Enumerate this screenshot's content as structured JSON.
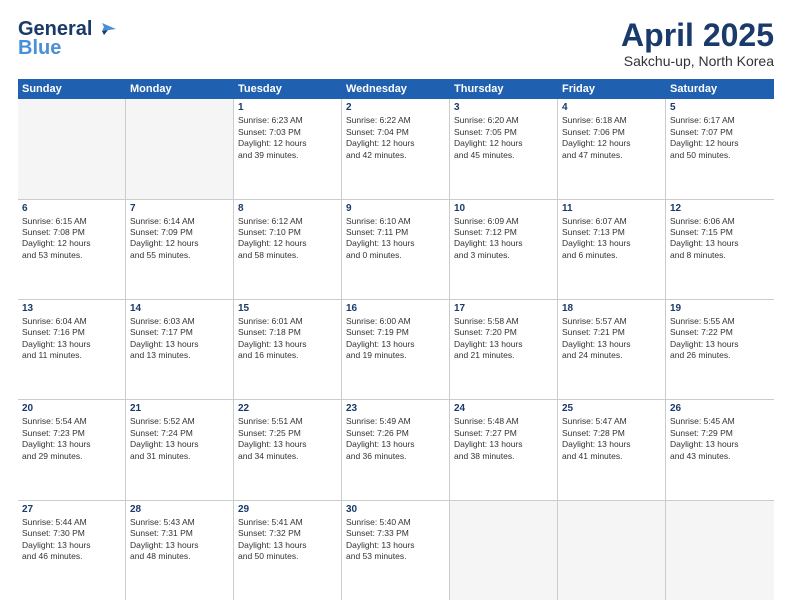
{
  "header": {
    "logo_general": "General",
    "logo_blue": "Blue",
    "title": "April 2025",
    "subtitle": "Sakchu-up, North Korea"
  },
  "weekdays": [
    "Sunday",
    "Monday",
    "Tuesday",
    "Wednesday",
    "Thursday",
    "Friday",
    "Saturday"
  ],
  "weeks": [
    [
      {
        "day": "",
        "lines": []
      },
      {
        "day": "",
        "lines": []
      },
      {
        "day": "1",
        "lines": [
          "Sunrise: 6:23 AM",
          "Sunset: 7:03 PM",
          "Daylight: 12 hours",
          "and 39 minutes."
        ]
      },
      {
        "day": "2",
        "lines": [
          "Sunrise: 6:22 AM",
          "Sunset: 7:04 PM",
          "Daylight: 12 hours",
          "and 42 minutes."
        ]
      },
      {
        "day": "3",
        "lines": [
          "Sunrise: 6:20 AM",
          "Sunset: 7:05 PM",
          "Daylight: 12 hours",
          "and 45 minutes."
        ]
      },
      {
        "day": "4",
        "lines": [
          "Sunrise: 6:18 AM",
          "Sunset: 7:06 PM",
          "Daylight: 12 hours",
          "and 47 minutes."
        ]
      },
      {
        "day": "5",
        "lines": [
          "Sunrise: 6:17 AM",
          "Sunset: 7:07 PM",
          "Daylight: 12 hours",
          "and 50 minutes."
        ]
      }
    ],
    [
      {
        "day": "6",
        "lines": [
          "Sunrise: 6:15 AM",
          "Sunset: 7:08 PM",
          "Daylight: 12 hours",
          "and 53 minutes."
        ]
      },
      {
        "day": "7",
        "lines": [
          "Sunrise: 6:14 AM",
          "Sunset: 7:09 PM",
          "Daylight: 12 hours",
          "and 55 minutes."
        ]
      },
      {
        "day": "8",
        "lines": [
          "Sunrise: 6:12 AM",
          "Sunset: 7:10 PM",
          "Daylight: 12 hours",
          "and 58 minutes."
        ]
      },
      {
        "day": "9",
        "lines": [
          "Sunrise: 6:10 AM",
          "Sunset: 7:11 PM",
          "Daylight: 13 hours",
          "and 0 minutes."
        ]
      },
      {
        "day": "10",
        "lines": [
          "Sunrise: 6:09 AM",
          "Sunset: 7:12 PM",
          "Daylight: 13 hours",
          "and 3 minutes."
        ]
      },
      {
        "day": "11",
        "lines": [
          "Sunrise: 6:07 AM",
          "Sunset: 7:13 PM",
          "Daylight: 13 hours",
          "and 6 minutes."
        ]
      },
      {
        "day": "12",
        "lines": [
          "Sunrise: 6:06 AM",
          "Sunset: 7:15 PM",
          "Daylight: 13 hours",
          "and 8 minutes."
        ]
      }
    ],
    [
      {
        "day": "13",
        "lines": [
          "Sunrise: 6:04 AM",
          "Sunset: 7:16 PM",
          "Daylight: 13 hours",
          "and 11 minutes."
        ]
      },
      {
        "day": "14",
        "lines": [
          "Sunrise: 6:03 AM",
          "Sunset: 7:17 PM",
          "Daylight: 13 hours",
          "and 13 minutes."
        ]
      },
      {
        "day": "15",
        "lines": [
          "Sunrise: 6:01 AM",
          "Sunset: 7:18 PM",
          "Daylight: 13 hours",
          "and 16 minutes."
        ]
      },
      {
        "day": "16",
        "lines": [
          "Sunrise: 6:00 AM",
          "Sunset: 7:19 PM",
          "Daylight: 13 hours",
          "and 19 minutes."
        ]
      },
      {
        "day": "17",
        "lines": [
          "Sunrise: 5:58 AM",
          "Sunset: 7:20 PM",
          "Daylight: 13 hours",
          "and 21 minutes."
        ]
      },
      {
        "day": "18",
        "lines": [
          "Sunrise: 5:57 AM",
          "Sunset: 7:21 PM",
          "Daylight: 13 hours",
          "and 24 minutes."
        ]
      },
      {
        "day": "19",
        "lines": [
          "Sunrise: 5:55 AM",
          "Sunset: 7:22 PM",
          "Daylight: 13 hours",
          "and 26 minutes."
        ]
      }
    ],
    [
      {
        "day": "20",
        "lines": [
          "Sunrise: 5:54 AM",
          "Sunset: 7:23 PM",
          "Daylight: 13 hours",
          "and 29 minutes."
        ]
      },
      {
        "day": "21",
        "lines": [
          "Sunrise: 5:52 AM",
          "Sunset: 7:24 PM",
          "Daylight: 13 hours",
          "and 31 minutes."
        ]
      },
      {
        "day": "22",
        "lines": [
          "Sunrise: 5:51 AM",
          "Sunset: 7:25 PM",
          "Daylight: 13 hours",
          "and 34 minutes."
        ]
      },
      {
        "day": "23",
        "lines": [
          "Sunrise: 5:49 AM",
          "Sunset: 7:26 PM",
          "Daylight: 13 hours",
          "and 36 minutes."
        ]
      },
      {
        "day": "24",
        "lines": [
          "Sunrise: 5:48 AM",
          "Sunset: 7:27 PM",
          "Daylight: 13 hours",
          "and 38 minutes."
        ]
      },
      {
        "day": "25",
        "lines": [
          "Sunrise: 5:47 AM",
          "Sunset: 7:28 PM",
          "Daylight: 13 hours",
          "and 41 minutes."
        ]
      },
      {
        "day": "26",
        "lines": [
          "Sunrise: 5:45 AM",
          "Sunset: 7:29 PM",
          "Daylight: 13 hours",
          "and 43 minutes."
        ]
      }
    ],
    [
      {
        "day": "27",
        "lines": [
          "Sunrise: 5:44 AM",
          "Sunset: 7:30 PM",
          "Daylight: 13 hours",
          "and 46 minutes."
        ]
      },
      {
        "day": "28",
        "lines": [
          "Sunrise: 5:43 AM",
          "Sunset: 7:31 PM",
          "Daylight: 13 hours",
          "and 48 minutes."
        ]
      },
      {
        "day": "29",
        "lines": [
          "Sunrise: 5:41 AM",
          "Sunset: 7:32 PM",
          "Daylight: 13 hours",
          "and 50 minutes."
        ]
      },
      {
        "day": "30",
        "lines": [
          "Sunrise: 5:40 AM",
          "Sunset: 7:33 PM",
          "Daylight: 13 hours",
          "and 53 minutes."
        ]
      },
      {
        "day": "",
        "lines": []
      },
      {
        "day": "",
        "lines": []
      },
      {
        "day": "",
        "lines": []
      }
    ]
  ]
}
